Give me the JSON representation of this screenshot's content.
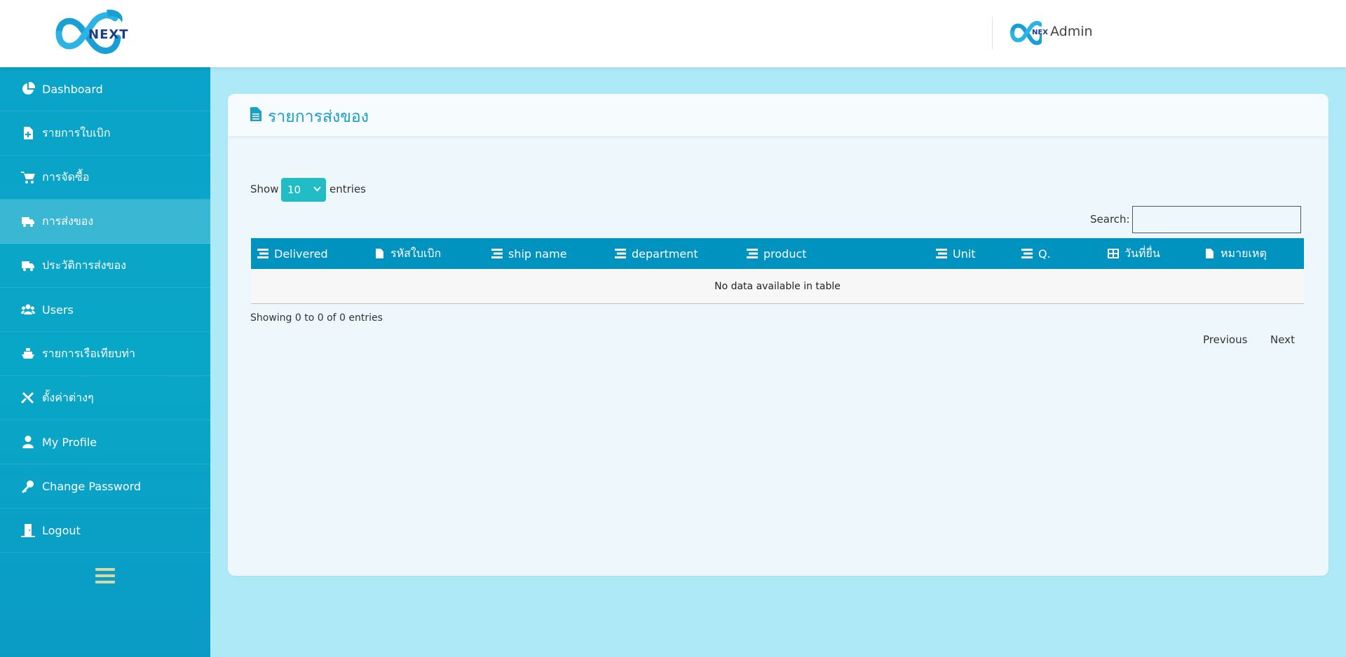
{
  "header": {
    "logo_text": "NEXT",
    "user_avatar_text": "NEX",
    "user_name": "Admin"
  },
  "sidebar": {
    "items": [
      {
        "label": "Dashboard",
        "icon": "chart-pie-icon",
        "active": false
      },
      {
        "label": "รายการใบเบิก",
        "icon": "file-plus-icon",
        "active": false
      },
      {
        "label": "การจัดซื้อ",
        "icon": "cart-icon",
        "active": false
      },
      {
        "label": "การส่งของ",
        "icon": "truck-icon",
        "active": true
      },
      {
        "label": "ประวัติการส่งของ",
        "icon": "truck-icon",
        "active": false
      },
      {
        "label": "Users",
        "icon": "users-icon",
        "active": false
      },
      {
        "label": "รายการเรือเทียบท่า",
        "icon": "ship-icon",
        "active": false
      },
      {
        "label": "ตั้งค่าต่างๆ",
        "icon": "tools-icon",
        "active": false
      },
      {
        "label": "My Profile",
        "icon": "user-icon",
        "active": false
      },
      {
        "label": "Change Password",
        "icon": "key-icon",
        "active": false
      },
      {
        "label": "Logout",
        "icon": "door-icon",
        "active": false
      }
    ],
    "toggle_icon": "hamburger-icon"
  },
  "main": {
    "title": "รายการส่งของ",
    "title_icon": "file-icon",
    "show_label": "Show",
    "entries_value": "10",
    "entries_label": "entries",
    "search_label": "Search:",
    "search_value": "",
    "columns": [
      "Delivered",
      "รหัสใบเบิก",
      "ship name",
      "department",
      "product",
      "Unit",
      "Q.",
      "วันที่ยื่น",
      "หมายเหตุ"
    ],
    "empty_message": "No data available in table",
    "info": "Showing 0 to 0 of 0 entries",
    "previous_label": "Previous",
    "next_label": "Next"
  },
  "colors": {
    "page_bg": "#aee9f8",
    "sidebar": "#0aa3c9",
    "table_header": "#0093c0",
    "accent": "#21bcc6",
    "title": "#1aa0c3"
  }
}
